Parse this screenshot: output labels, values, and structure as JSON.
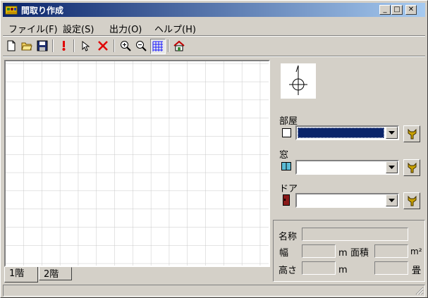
{
  "window": {
    "title": "間取り作成",
    "minimize": "_",
    "maximize": "□",
    "close": "✕"
  },
  "menu": [
    {
      "label": "ファイル(F)"
    },
    {
      "label": "設定(S)"
    },
    {
      "label": "出力(O)"
    },
    {
      "label": "ヘルプ(H)"
    }
  ],
  "toolbar": {
    "icons": [
      "new-file-icon",
      "open-folder-icon",
      "save-icon",
      "pin-icon",
      "select-arrow-icon",
      "delete-x-icon",
      "zoom-in-icon",
      "zoom-out-icon",
      "grid-icon",
      "house-icon"
    ]
  },
  "canvas": {
    "grid": true
  },
  "tabs": [
    {
      "label": "1階",
      "active": true
    },
    {
      "label": "2階",
      "active": false
    }
  ],
  "panel": {
    "room": {
      "label": "部屋",
      "selected_color": "#0a246a"
    },
    "window": {
      "label": "窓"
    },
    "door": {
      "label": "ドア"
    }
  },
  "info": {
    "name_label": "名称",
    "width_label": "幅",
    "width_unit": "m",
    "area_label": "面積",
    "area_unit": "m²",
    "height_label": "高さ",
    "height_unit": "m",
    "tatami_unit": "畳"
  },
  "colors": {
    "selection": "#0a246a",
    "delete": "#e00000",
    "grid": "#1a1aff"
  }
}
